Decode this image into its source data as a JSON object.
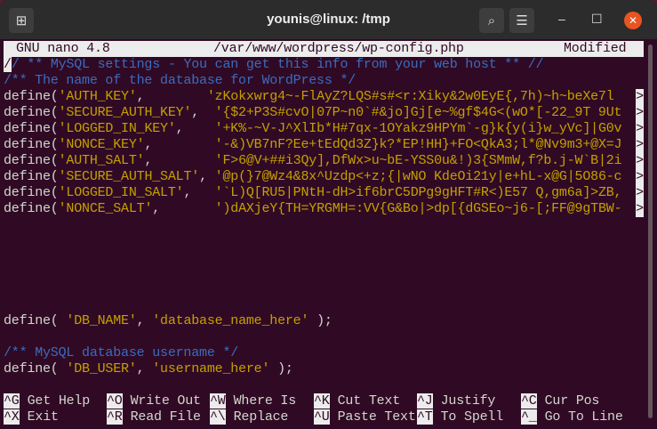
{
  "window": {
    "title": "younis@linux: /tmp",
    "icons": [
      "new-tab-icon",
      "search-icon",
      "hamburger-menu-icon",
      "minimize-icon",
      "maximize-icon",
      "close-icon"
    ]
  },
  "nano": {
    "version": "GNU nano 4.8",
    "file": "/var/www/wordpress/wp-config.php",
    "status": "Modified"
  },
  "lines": {
    "comment1": "// ** MySQL settings - You can get this info from your web host ** //",
    "comment2": "/** The name of the database for WordPress */",
    "keys": [
      {
        "name": "'AUTH_KEY'",
        "pad": ",        ",
        "value": "'zKokxwrg4~-FlAyZ?LQS#s#<r:Xiky&2w0EyE{,7h)~h~beXe7l"
      },
      {
        "name": "'SECURE_AUTH_KEY'",
        "pad": ",  ",
        "value": "'{$2+P3S#cvO|07P~n0`#&jo]Gj[e~%gf$4G<(wO*[-22_9T 9Ut"
      },
      {
        "name": "'LOGGED_IN_KEY'",
        "pad": ",    ",
        "value": "'+K%-~V-J^XlIb*H#7qx-1OYakz9HPYm`-g}k{y(i}w_yVc]|G0v"
      },
      {
        "name": "'NONCE_KEY'",
        "pad": ",        ",
        "value": "'-&)VB7nF?Ee+tEdQd3Z}k?*EP!HH}+FO<QkA3;l*@Nv9m3+@X=J"
      },
      {
        "name": "'AUTH_SALT'",
        "pad": ",        ",
        "value": "'F>6@V+##i3Qy],DfWx>u~bE-YSS0u&!)3{SMmW,f?b.j-W`B|2i"
      },
      {
        "name": "'SECURE_AUTH_SALT'",
        "pad": ", ",
        "value": "'@p(}7@Wz4&8x^Uzdp<+z;{|wNO KdeOi21y|e+hL-x@G|5O86-c"
      },
      {
        "name": "'LOGGED_IN_SALT'",
        "pad": ",   ",
        "value": "'`L)Q[RU5|PNtH-dH>if6brC5DPg9gHFT#R<)E57 Q,gm6a]>ZB,"
      },
      {
        "name": "'NONCE_SALT'",
        "pad": ",       ",
        "value": "')dAXjeY{TH=YRGMH=:VV{G&Bo|>dp[{dGSEo~j6-[;FF@9gTBW-"
      }
    ],
    "define": "define(",
    "more": ">",
    "db_name": {
      "pre": "define( ",
      "key": "'DB_NAME'",
      "mid": ", ",
      "val": "'database_name_here'",
      "post": " );"
    },
    "comment3": "/** MySQL database username */",
    "db_user": {
      "pre": "define( ",
      "key": "'DB_USER'",
      "mid": ", ",
      "val": "'username_here'",
      "post": " );"
    }
  },
  "shortcuts": [
    {
      "key": "^G",
      "label": "Get Help"
    },
    {
      "key": "^O",
      "label": "Write Out"
    },
    {
      "key": "^W",
      "label": "Where Is"
    },
    {
      "key": "^K",
      "label": "Cut Text"
    },
    {
      "key": "^J",
      "label": "Justify"
    },
    {
      "key": "^C",
      "label": "Cur Pos"
    },
    {
      "key": "^X",
      "label": "Exit"
    },
    {
      "key": "^R",
      "label": "Read File"
    },
    {
      "key": "^\\",
      "label": "Replace"
    },
    {
      "key": "^U",
      "label": "Paste Text"
    },
    {
      "key": "^T",
      "label": "To Spell"
    },
    {
      "key": "^_",
      "label": "Go To Line"
    }
  ]
}
